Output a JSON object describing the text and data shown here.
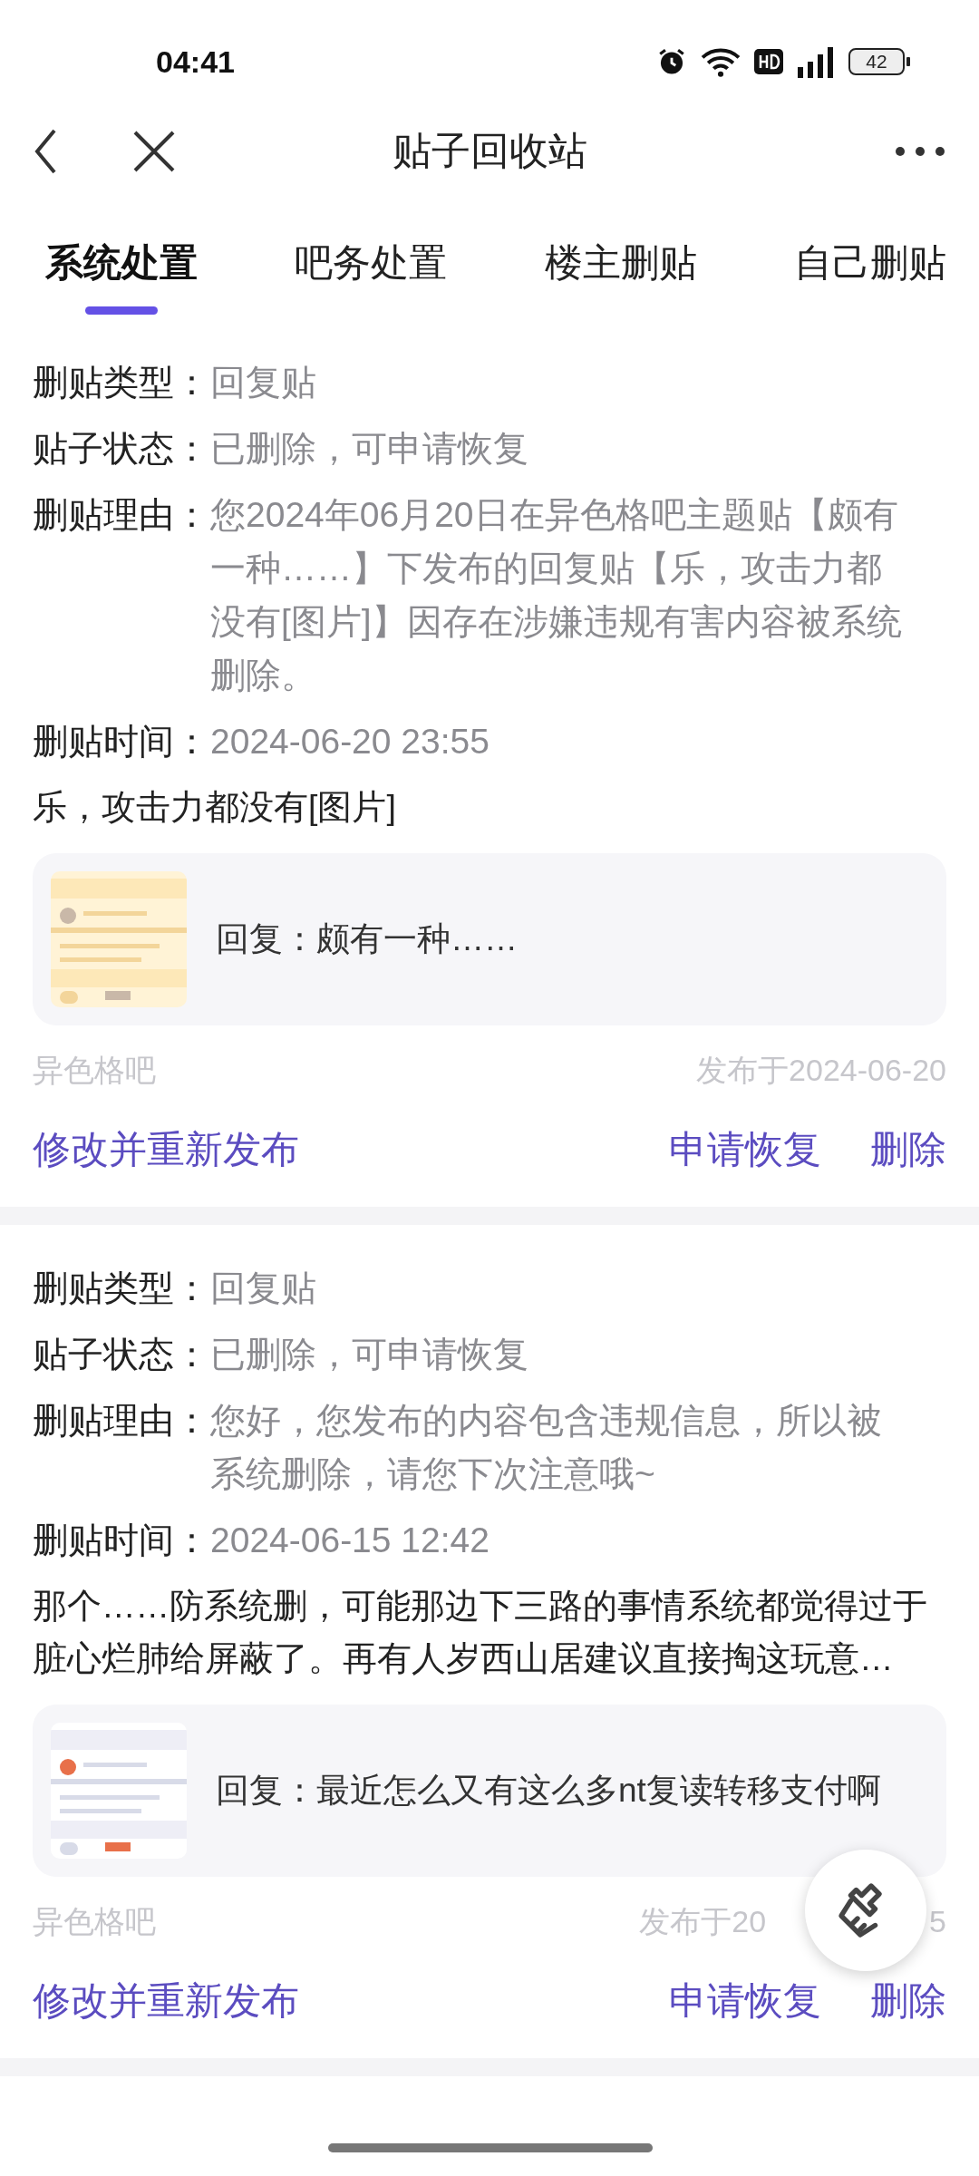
{
  "status_bar": {
    "time": "04:41",
    "battery": "42"
  },
  "nav": {
    "title": "贴子回收站"
  },
  "tabs": [
    {
      "label": "系统处置",
      "selected": true
    },
    {
      "label": "吧务处置",
      "selected": false
    },
    {
      "label": "楼主删贴",
      "selected": false
    },
    {
      "label": "自己删贴",
      "selected": false
    }
  ],
  "posts": [
    {
      "fields": [
        {
          "label": "删贴类型：",
          "value": "回复贴"
        },
        {
          "label": "贴子状态：",
          "value": "已删除，可申请恢复"
        },
        {
          "label": "删贴理由：",
          "value": "您2024年06月20日在异色格吧主题贴【颇有一种……】下发布的回复贴【乐，攻击力都没有[图片]】因存在涉嫌违规有害内容被系统删除。"
        },
        {
          "label": "删贴时间：",
          "value": "2024-06-20 23:55"
        }
      ],
      "content": "乐，攻击力都没有[图片]",
      "quote": {
        "text": "回复：颇有一种……"
      },
      "forum": "异色格吧",
      "date": "发布于2024-06-20",
      "actions": [
        "修改并重新发布",
        "申请恢复",
        "删除"
      ]
    },
    {
      "fields": [
        {
          "label": "删贴类型：",
          "value": "回复贴"
        },
        {
          "label": "贴子状态：",
          "value": "已删除，可申请恢复"
        },
        {
          "label": "删贴理由：",
          "value": "您好，您发布的内容包含违规信息，所以被系统删除，请您下次注意哦~"
        },
        {
          "label": "删贴时间：",
          "value": "2024-06-15 12:42"
        }
      ],
      "content": "那个……防系统删，可能那边下三路的事情系统都觉得过于脏心烂肺给屏蔽了。再有人岁西山居建议直接掏这玩意…",
      "quote": {
        "text": "回复：最近怎么又有这么多nt复读转移支付啊"
      },
      "forum": "异色格吧",
      "date": "发布于20",
      "date_tail": "5",
      "actions": [
        "修改并重新发布",
        "申请恢复",
        "删除"
      ]
    }
  ]
}
